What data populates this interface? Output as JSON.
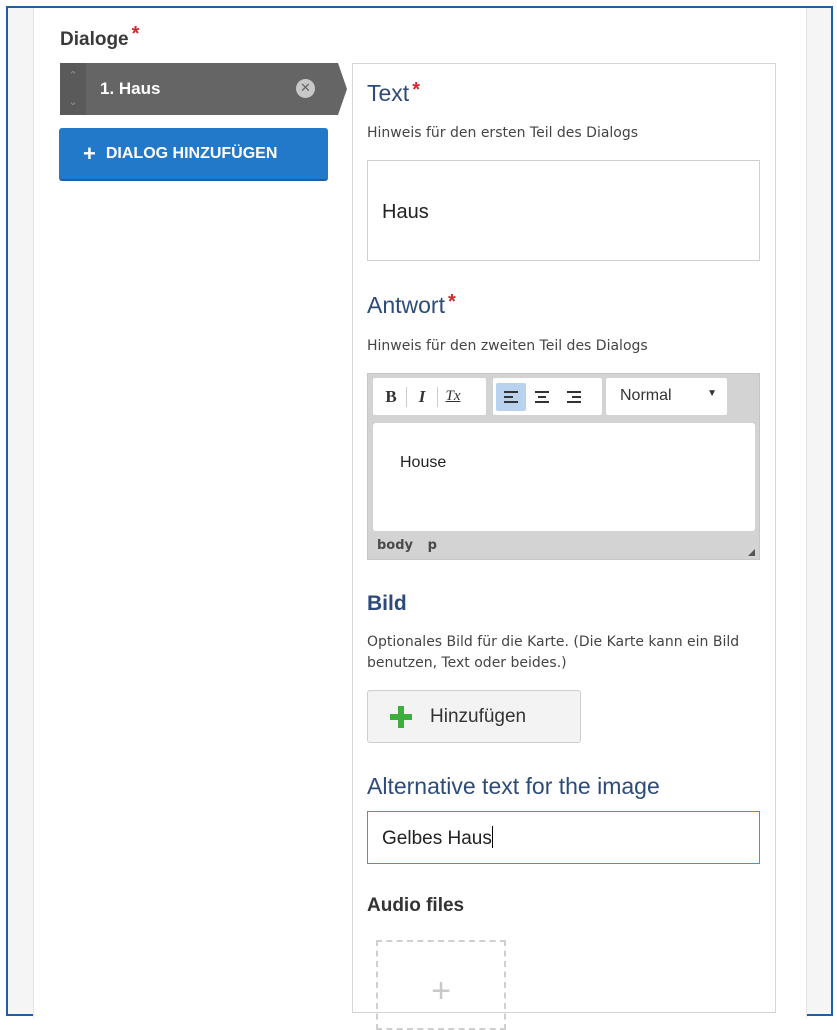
{
  "dialogs": {
    "label": "Dialoge",
    "required_mark": "*",
    "items": [
      {
        "label": "1. Haus"
      }
    ],
    "add_button_label": "DIALOG HINZUFÜGEN"
  },
  "text_field": {
    "label": "Text",
    "required_mark": "*",
    "description": "Hinweis für den ersten Teil des Dialogs",
    "value": "Haus"
  },
  "answer_field": {
    "label": "Antwort",
    "required_mark": "*",
    "description": "Hinweis für den zweiten Teil des Dialogs",
    "toolbar": {
      "bold": "B",
      "italic": "I",
      "remove_format": "Tx",
      "format_select": "Normal"
    },
    "value": "House",
    "path": [
      "body",
      "p"
    ]
  },
  "image_field": {
    "label": "Bild",
    "description": "Optionales Bild für die Karte. (Die Karte kann ein Bild benutzen, Text oder beides.)",
    "add_button_label": "Hinzufügen"
  },
  "alt_text_field": {
    "label": "Alternative text for the image",
    "value": "Gelbes Haus"
  },
  "audio_field": {
    "label": "Audio files",
    "add_symbol": "+"
  },
  "colors": {
    "primary_button": "#2379c9",
    "label_blue": "#2d4b7a",
    "required": "#d5262c",
    "add_green": "#3cae3c",
    "list_item_bg": "#656565"
  }
}
